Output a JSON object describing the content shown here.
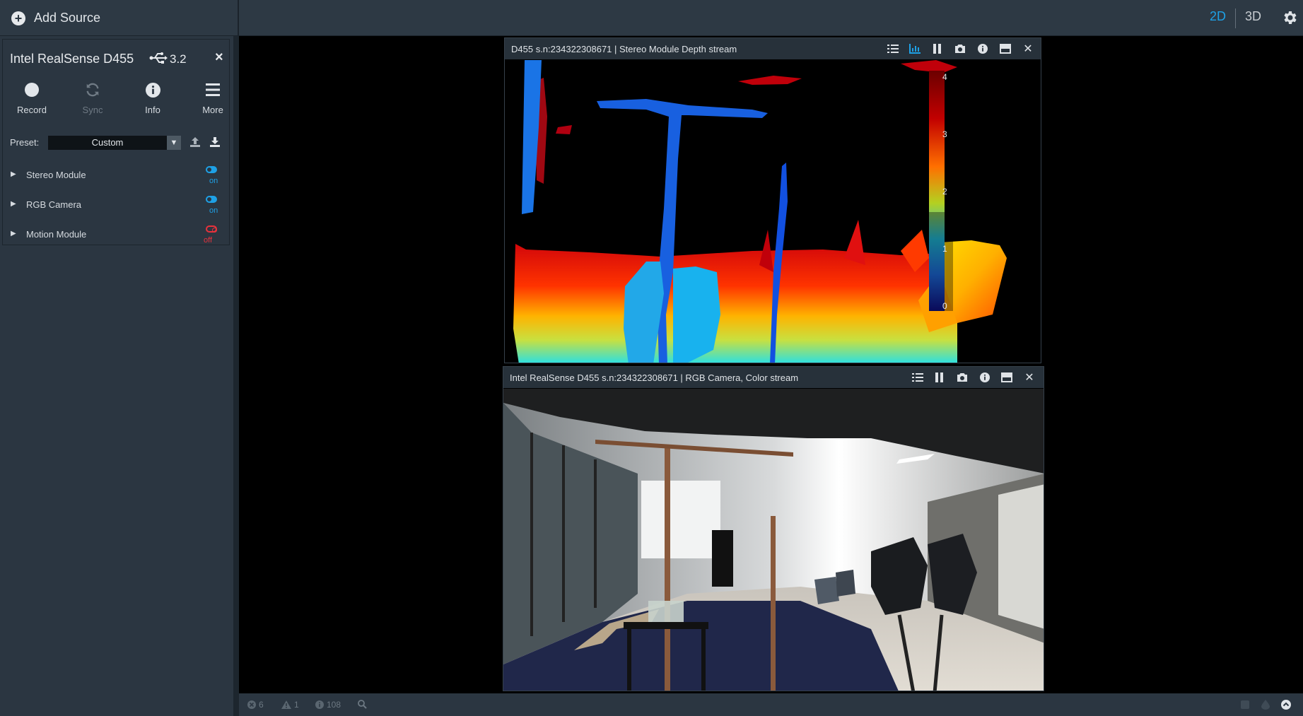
{
  "topbar": {
    "add_source_label": "Add Source",
    "view_2d": "2D",
    "view_3d": "3D",
    "active_view": "2D"
  },
  "device": {
    "name": "Intel RealSense D455",
    "usb_version": "3.2",
    "close": "×",
    "tools": {
      "record": "Record",
      "sync": "Sync",
      "info": "Info",
      "more": "More"
    },
    "preset": {
      "label": "Preset:",
      "value": "Custom"
    },
    "modules": [
      {
        "name": "Stereo Module",
        "state": "on"
      },
      {
        "name": "RGB Camera",
        "state": "on"
      },
      {
        "name": "Motion Module",
        "state": "off"
      }
    ]
  },
  "streams": {
    "depth": {
      "title": "D455 s.n:234322308671 | Stereo Module Depth stream",
      "colormap_ticks": [
        "4",
        "3",
        "2",
        "1",
        "0"
      ]
    },
    "color": {
      "title": "Intel RealSense D455 s.n:234322308671 | RGB Camera, Color stream"
    }
  },
  "statusbar": {
    "errors": "6",
    "warnings": "1",
    "infos": "108"
  },
  "colors": {
    "accent": "#1ea1e6",
    "off": "#e8323c",
    "panel": "#2b3641",
    "topbar": "#2d3944"
  }
}
